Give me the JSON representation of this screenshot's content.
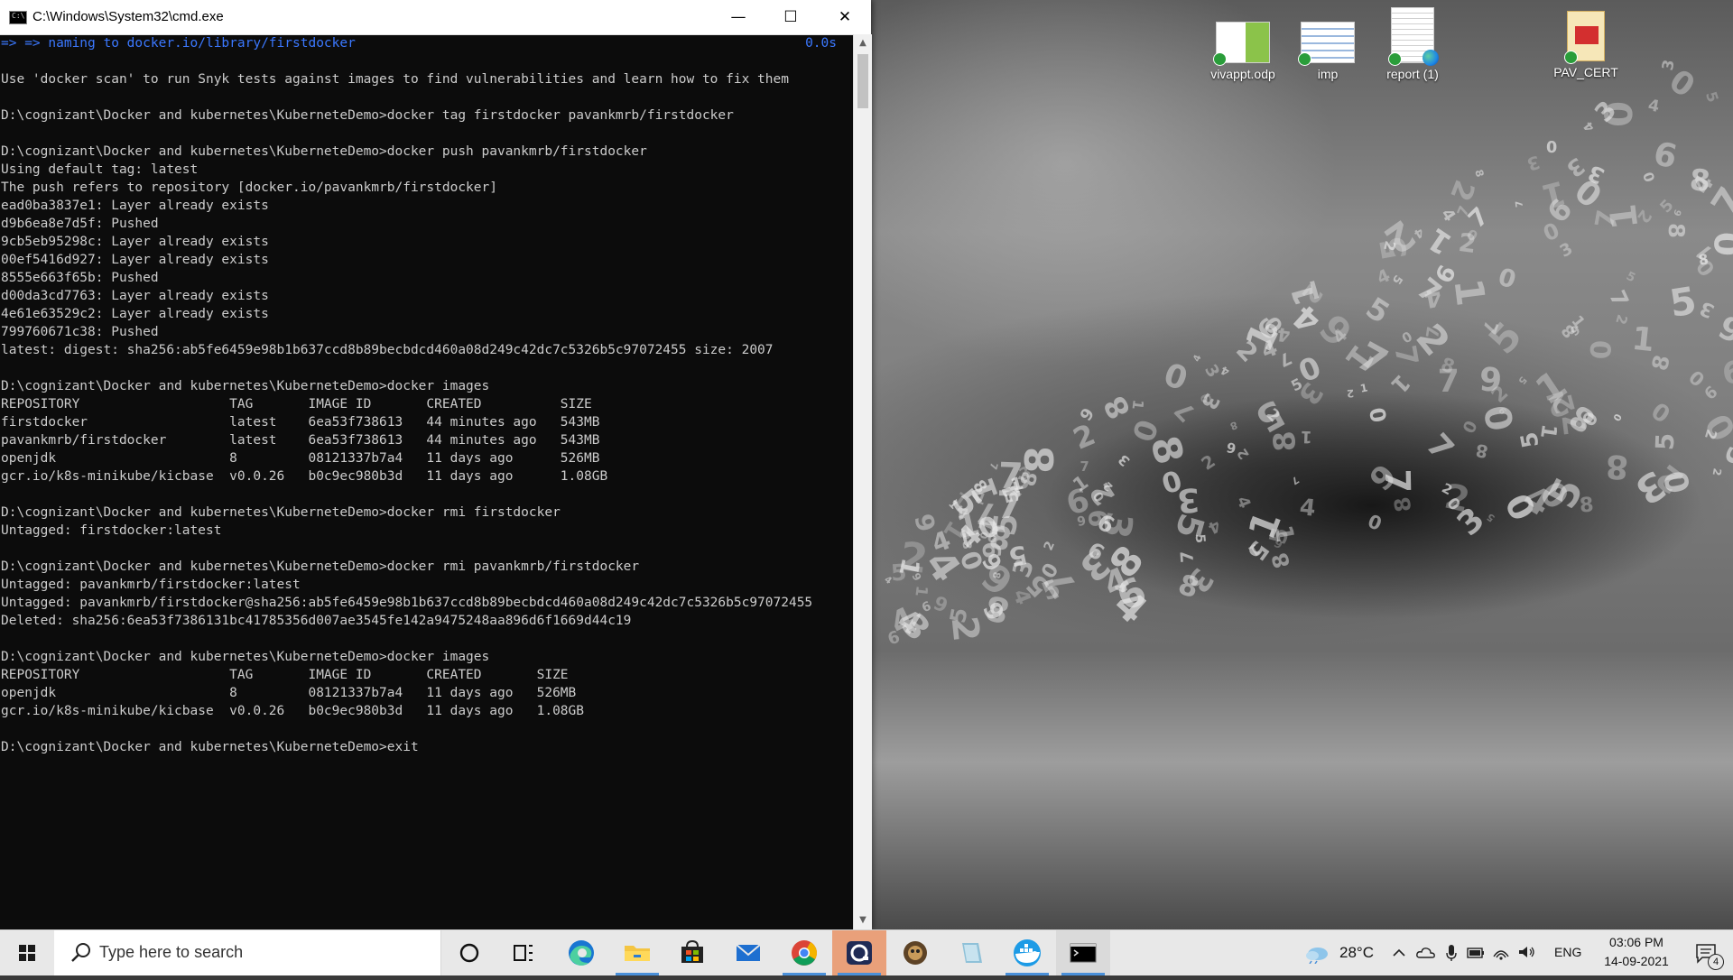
{
  "window": {
    "title": "C:\\Windows\\System32\\cmd.exe",
    "icon_text": "C:\\",
    "minimize": "—",
    "maximize": "☐",
    "close": "✕"
  },
  "console": {
    "elapsed": "0.0s",
    "lines": [
      "=> => naming to docker.io/library/firstdocker",
      "",
      "Use 'docker scan' to run Snyk tests against images to find vulnerabilities and learn how to fix them",
      "",
      "D:\\cognizant\\Docker and kubernetes\\KuberneteDemo>docker tag firstdocker pavankmrb/firstdocker",
      "",
      "D:\\cognizant\\Docker and kubernetes\\KuberneteDemo>docker push pavankmrb/firstdocker",
      "Using default tag: latest",
      "The push refers to repository [docker.io/pavankmrb/firstdocker]",
      "ead0ba3837e1: Layer already exists",
      "d9b6ea8e7d5f: Pushed",
      "9cb5eb95298c: Layer already exists",
      "00ef5416d927: Layer already exists",
      "8555e663f65b: Pushed",
      "d00da3cd7763: Layer already exists",
      "4e61e63529c2: Layer already exists",
      "799760671c38: Pushed",
      "latest: digest: sha256:ab5fe6459e98b1b637ccd8b89becbdcd460a08d249c42dc7c5326b5c97072455 size: 2007",
      "",
      "D:\\cognizant\\Docker and kubernetes\\KuberneteDemo>docker images",
      "REPOSITORY                   TAG       IMAGE ID       CREATED          SIZE",
      "firstdocker                  latest    6ea53f738613   44 minutes ago   543MB",
      "pavankmrb/firstdocker        latest    6ea53f738613   44 minutes ago   543MB",
      "openjdk                      8         08121337b7a4   11 days ago      526MB",
      "gcr.io/k8s-minikube/kicbase  v0.0.26   b0c9ec980b3d   11 days ago      1.08GB",
      "",
      "D:\\cognizant\\Docker and kubernetes\\KuberneteDemo>docker rmi firstdocker",
      "Untagged: firstdocker:latest",
      "",
      "D:\\cognizant\\Docker and kubernetes\\KuberneteDemo>docker rmi pavankmrb/firstdocker",
      "Untagged: pavankmrb/firstdocker:latest",
      "Untagged: pavankmrb/firstdocker@sha256:ab5fe6459e98b1b637ccd8b89becbdcd460a08d249c42dc7c5326b5c97072455",
      "Deleted: sha256:6ea53f7386131bc41785356d007ae3545fe142a9475248aa896d6f1669d44c19",
      "",
      "D:\\cognizant\\Docker and kubernetes\\KuberneteDemo>docker images",
      "REPOSITORY                   TAG       IMAGE ID       CREATED       SIZE",
      "openjdk                      8         08121337b7a4   11 days ago   526MB",
      "gcr.io/k8s-minikube/kicbase  v0.0.26   b0c9ec980b3d   11 days ago   1.08GB",
      "",
      "D:\\cognizant\\Docker and kubernetes\\KuberneteDemo>exit"
    ]
  },
  "desktop": {
    "icons": [
      {
        "label": "vivappt.odp",
        "icon": "presentation-file-icon"
      },
      {
        "label": "imp",
        "icon": "document-file-icon"
      },
      {
        "label": "report (1)",
        "icon": "edge-pdf-file-icon"
      },
      {
        "label": "PAV_CERT",
        "icon": "pdf-file-icon"
      }
    ]
  },
  "taskbar": {
    "search_placeholder": "Type here to search",
    "apps": [
      {
        "name": "cortana",
        "icon": "cortana-circle-icon"
      },
      {
        "name": "task-view",
        "icon": "task-view-icon"
      },
      {
        "name": "edge",
        "icon": "edge-browser-icon"
      },
      {
        "name": "file-explorer",
        "icon": "folder-icon"
      },
      {
        "name": "store",
        "icon": "store-bag-icon"
      },
      {
        "name": "mail",
        "icon": "mail-envelope-icon"
      },
      {
        "name": "chrome",
        "icon": "chrome-browser-icon"
      },
      {
        "name": "teams-like",
        "icon": "app-icon"
      },
      {
        "name": "game",
        "icon": "game-icon"
      },
      {
        "name": "notepad-like",
        "icon": "notes-icon"
      },
      {
        "name": "docker",
        "icon": "docker-whale-icon"
      },
      {
        "name": "cmd",
        "icon": "terminal-icon"
      }
    ],
    "weather": "28°C",
    "language": "ENG",
    "time": "03:06 PM",
    "date": "14-09-2021",
    "notifications": "4"
  },
  "colors": {
    "console_bg": "#0c0c0c",
    "console_fg": "#cccccc",
    "console_blue": "#3b78ff",
    "taskbar_bg": "#e8e8e8",
    "accent": "#4a90d9"
  }
}
